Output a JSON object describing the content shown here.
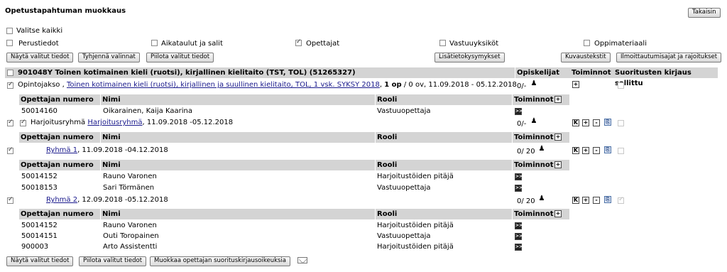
{
  "page": {
    "title": "Opetustapahtuman muokkaus",
    "back_button": "Takaisin"
  },
  "filters": {
    "select_all": "Valitse kaikki",
    "options": [
      {
        "label": "Perustiedot",
        "checked": false
      },
      {
        "label": "Aikataulut ja salit",
        "checked": false
      },
      {
        "label": "Opettajat",
        "checked": true
      },
      {
        "label": "Vastuuyksiköt",
        "checked": false
      },
      {
        "label": "Oppimateriaali",
        "checked": false
      }
    ]
  },
  "toolbar_top": {
    "show_selected": "Näytä valitut tiedot",
    "clear_selections": "Tyhjennä valinnat",
    "hide_selected": "Piilota valitut tiedot",
    "extra_questions": "Lisätietokysymykset",
    "description_texts": "Kuvaustekstit",
    "enrollment_times": "Ilmoittautumisajat ja rajoitukset"
  },
  "course": {
    "heading": "901048Y Toinen kotimainen kieli (ruotsi), kirjallinen kielitaito (TST, TOL) (51265327)",
    "col_students": "Opiskelijat",
    "col_actions": "Toiminnot",
    "col_grading_allowed": "Suoritusten kirjaus sallittu"
  },
  "teacher_headers": {
    "number": "Opettajan numero",
    "name": "Nimi",
    "role": "Rooli",
    "actions": "Toiminnot"
  },
  "rows": {
    "period": {
      "prefix": "Opintojakso ,",
      "link": "Toinen kotimainen kieli (ruotsi), kirjallinen ja suullinen kielitaito, TOL, 1 vsk. SYKSY 2018",
      "credits_bold": "1 op",
      "details": "/ 0 ov, 11.09.2018 - 05.12.2018",
      "students": "0/-",
      "teachers": [
        {
          "number": "50014160",
          "name": "Oikarainen, Kaija Kaarina",
          "role": "Vastuuopettaja",
          "action": ">>"
        }
      ]
    },
    "exercise": {
      "prefix": "Harjoitusryhmä",
      "link": "Harjoitusryhmä",
      "dates": ", 11.09.2018 -05.12.2018",
      "students": "0/-"
    },
    "group1": {
      "link": "Ryhmä 1",
      "dates": ", 11.09.2018 -04.12.2018",
      "students": "0/ 20",
      "teachers": [
        {
          "number": "50014152",
          "name": "Rauno Varonen",
          "role": "Harjoitustöiden pitäjä",
          "action": ">>"
        },
        {
          "number": "50018153",
          "name": "Sari Törmänen",
          "role": "Vastuuopettaja",
          "action": ">>"
        }
      ]
    },
    "group2": {
      "link": "Ryhmä 2",
      "dates": ", 12.09.2018 -05.12.2018",
      "students": "0/ 20",
      "teachers": [
        {
          "number": "50014152",
          "name": "Rauno Varonen",
          "role": "Harjoitustöiden pitäjä",
          "action": ">>"
        },
        {
          "number": "50014151",
          "name": "Outi Toropainen",
          "role": "Vastuuopettaja",
          "action": ">>"
        },
        {
          "number": "900003",
          "name": "Arto Assistentti",
          "role": "Harjoitustöiden pitäjä",
          "action": ">>"
        }
      ]
    }
  },
  "toolbar_bottom": {
    "show_selected": "Näytä valitut tiedot",
    "hide_selected": "Piilota valitut tiedot",
    "edit_rights": "Muokkaa opettajan suorituskirjausoikeuksia"
  },
  "icons": {
    "add": "+",
    "remove": "-",
    "k": "K",
    "arrows": ">>",
    "person": "person-icon",
    "doc": "copy-icon",
    "envelope": "envelope-icon"
  }
}
